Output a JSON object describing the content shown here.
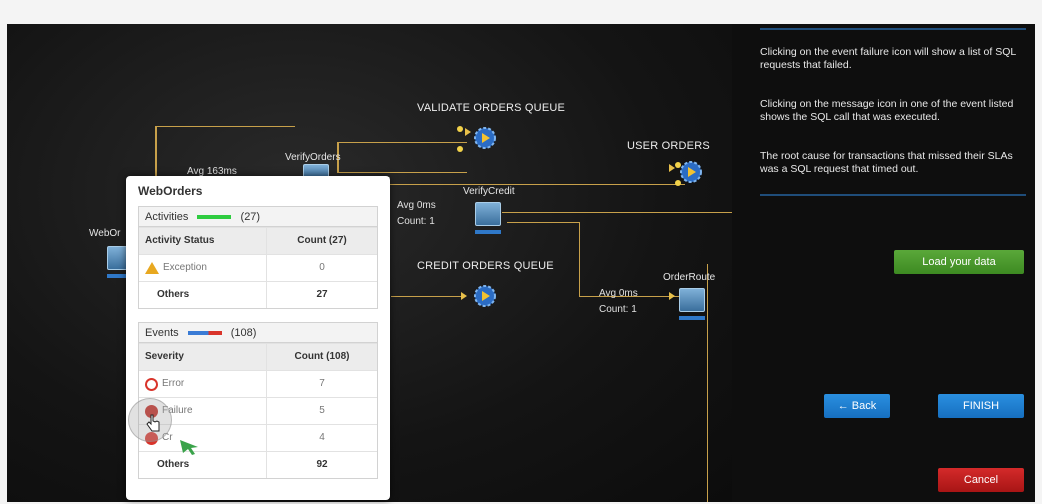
{
  "canvas": {
    "queues": {
      "validate": "VALIDATE ORDERS QUEUE",
      "user": "USER ORDERS",
      "credit": "CREDIT ORDERS QUEUE"
    },
    "nodes": {
      "web_orders": "WebOr",
      "verify_orders": "VerifyOrders",
      "verify_credit": "VerifyCredit",
      "order_routing": "OrderRoute"
    },
    "stats": {
      "web_avg": "Avg 163ms",
      "verify_credit_avg": "Avg 0ms",
      "verify_credit_count": "Count: 1",
      "order_route_avg": "Avg 0ms",
      "order_route_count": "Count: 1"
    },
    "close_symbol": "×"
  },
  "popup": {
    "title": "WebOrders",
    "activities": {
      "label": "Activities",
      "count": "(27)",
      "bar_color": "#2ecc40",
      "col1": "Activity Status",
      "col2": "Count (27)",
      "rows": [
        {
          "label": "Exception",
          "count": "0"
        },
        {
          "label": "Others",
          "count": "27"
        }
      ]
    },
    "events": {
      "label": "Events",
      "count": "(108)",
      "col1": "Severity",
      "col2": "Count (108)",
      "rows": [
        {
          "label": "Error",
          "count": "7",
          "icon": "error-icon"
        },
        {
          "label": "Failure",
          "count": "5",
          "icon": "failure-icon"
        },
        {
          "label": "Cr",
          "count": "4",
          "icon": "critical-icon"
        },
        {
          "label": "Others",
          "count": "92"
        }
      ]
    }
  },
  "panel": {
    "text1": "Clicking on the event failure icon will show a list of SQL requests that failed.",
    "text2": "Clicking on the message icon in one of the event listed shows the SQL call that was executed.",
    "text3": "The root cause for transactions that missed their SLAs was a SQL request that timed out.",
    "load_button": "Load your data",
    "back_button": "← Back",
    "finish_button": "FINISH",
    "cancel_button": "Cancel"
  },
  "colors": {
    "accent_green": "#3d8a22",
    "accent_blue": "#166fc0",
    "accent_red": "#a81515",
    "wire": "#c7a04a"
  }
}
